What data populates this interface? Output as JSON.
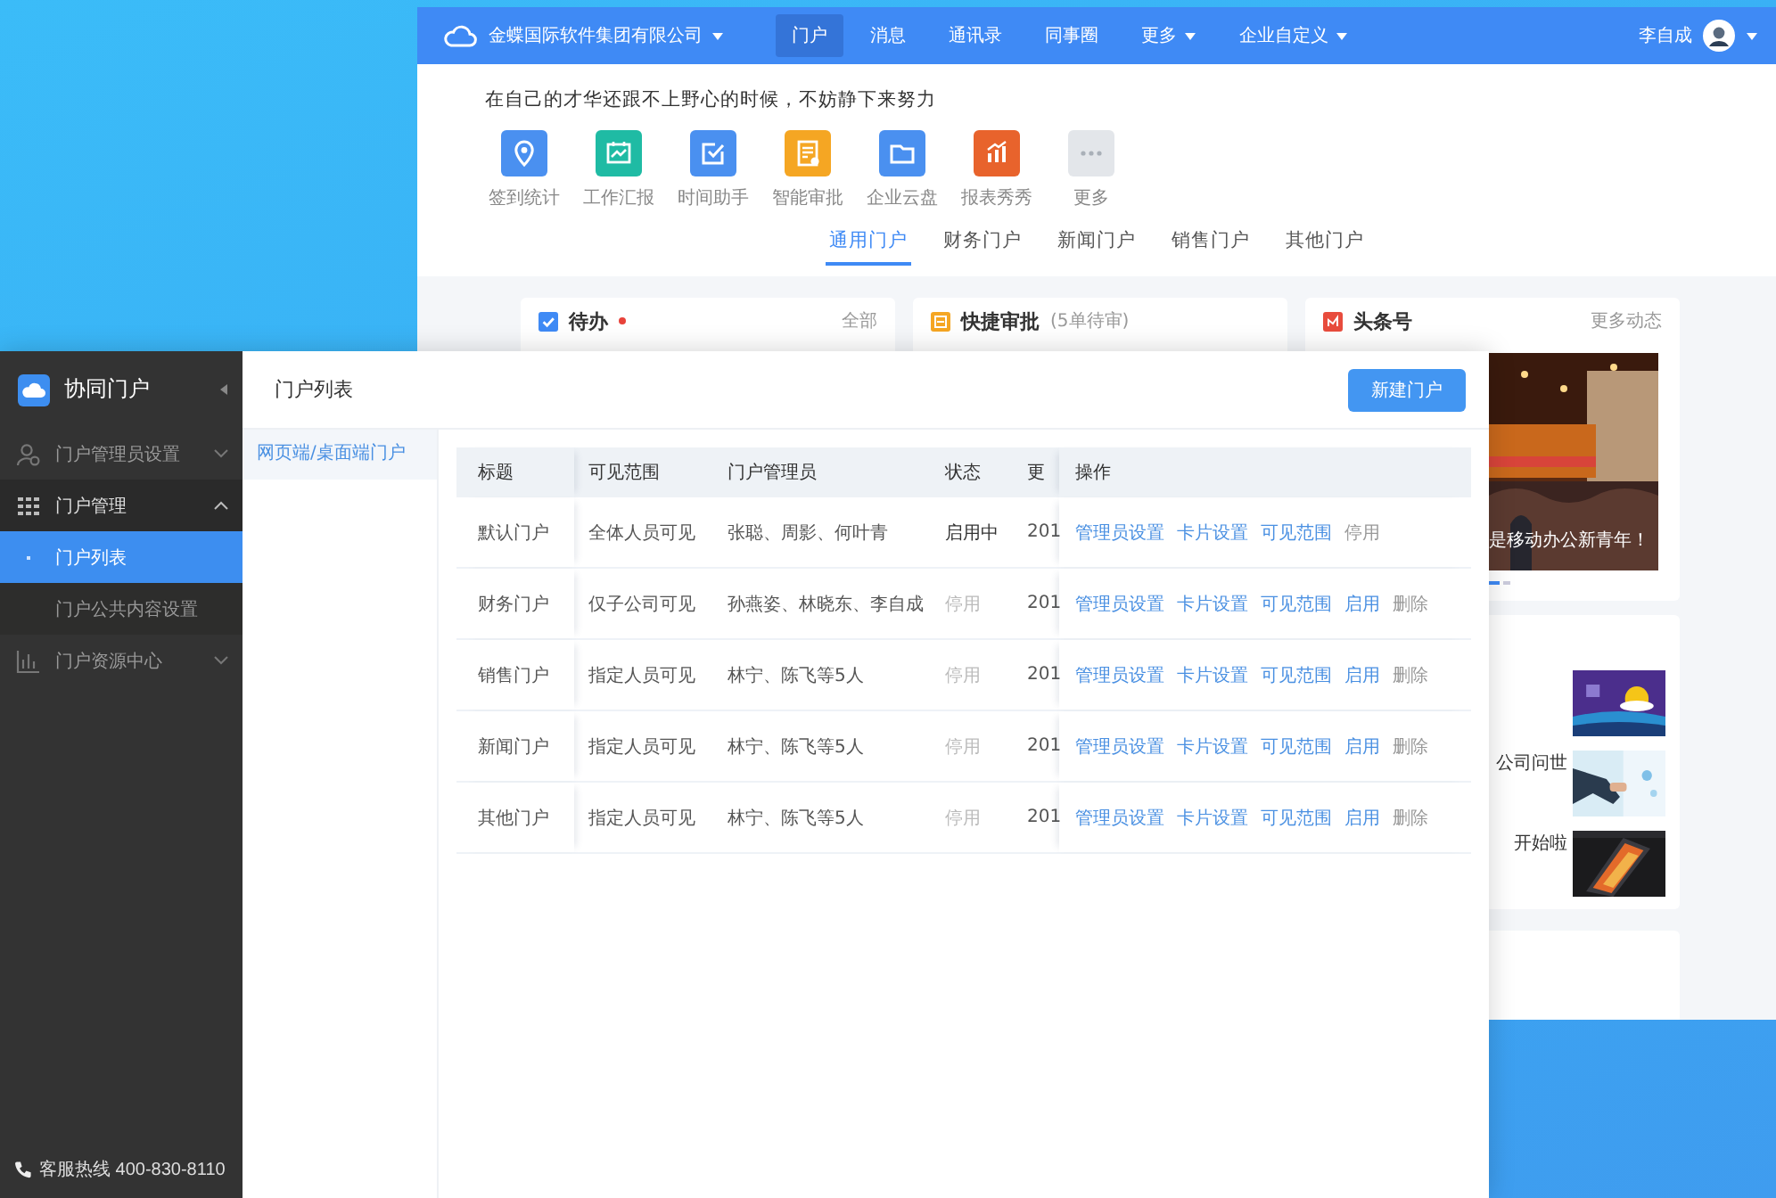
{
  "portal_window": {
    "top_bar": {
      "company": {
        "label": "金蝶国际软件集团有限公司",
        "has_menu": true
      },
      "nav": [
        {
          "label": "门户",
          "selected": true,
          "has_menu": false
        },
        {
          "label": "消息",
          "selected": false,
          "has_menu": false
        },
        {
          "label": "通讯录",
          "selected": false,
          "has_menu": false
        },
        {
          "label": "同事圈",
          "selected": false,
          "has_menu": false
        },
        {
          "label": "更多",
          "selected": false,
          "has_menu": true
        },
        {
          "label": "企业自定义",
          "selected": false,
          "has_menu": true
        }
      ],
      "user_name": "李自成"
    },
    "motto": "在自己的才华还跟不上野心的时候，不妨静下来努力",
    "apps": [
      {
        "label": "签到统计",
        "kind": "pin",
        "color": "#4a90f0"
      },
      {
        "label": "工作汇报",
        "kind": "chart",
        "color": "#1fbba4"
      },
      {
        "label": "时间助手",
        "kind": "check",
        "color": "#4a90f0"
      },
      {
        "label": "智能审批",
        "kind": "doc",
        "color": "#f5a623"
      },
      {
        "label": "企业云盘",
        "kind": "folder",
        "color": "#4a90f0"
      },
      {
        "label": "报表秀秀",
        "kind": "bars",
        "color": "#e8632c"
      },
      {
        "label": "更多",
        "kind": "more",
        "color": "#e3e6ea"
      }
    ],
    "tabs": [
      {
        "label": "通用门户",
        "selected": true
      },
      {
        "label": "财务门户",
        "selected": false
      },
      {
        "label": "新闻门户",
        "selected": false
      },
      {
        "label": "销售门户",
        "selected": false
      },
      {
        "label": "其他门户",
        "selected": false
      }
    ],
    "cards": [
      {
        "kind": "todo",
        "title": "待办",
        "alert": true,
        "link": "全部"
      },
      {
        "kind": "approval",
        "title": "快捷审批",
        "alert": false,
        "note": "(5单待审)"
      },
      {
        "kind": "news",
        "title": "头条号",
        "alert": false,
        "link": "更多动态",
        "caption": "是移动办公新青年！",
        "slides": [
          {
            "selected": true
          },
          {
            "selected": false
          }
        ]
      }
    ],
    "news_list": [
      {
        "kind": "picture"
      },
      {
        "kind": "picture",
        "title": "公司问世"
      },
      {
        "kind": "picture",
        "title": "开始啦"
      }
    ]
  },
  "admin_window": {
    "sidebar": {
      "title": "协同门户",
      "menu": [
        {
          "label": "门户管理员设置",
          "kind": "admin",
          "expanded": false
        },
        {
          "label": "门户管理",
          "kind": "grid",
          "expanded": true,
          "children": [
            {
              "label": "门户列表",
              "selected": true
            },
            {
              "label": "门户公共内容设置",
              "selected": false
            }
          ]
        },
        {
          "label": "门户资源中心",
          "kind": "chart",
          "expanded": false
        }
      ],
      "hotline": "客服热线 400-830-8110"
    },
    "page_title": "门户列表",
    "new_button": "新建门户",
    "sub_nav": [
      {
        "label": "网页端/桌面端门户",
        "selected": true
      }
    ],
    "table": {
      "columns": [
        "标题",
        "可见范围",
        "门户管理员",
        "状态",
        "更",
        "操作"
      ],
      "rows": [
        {
          "title": "默认门户",
          "scope": "全体人员可见",
          "admins": "张聪、周影、何叶青",
          "status": {
            "text": "启用中",
            "active": true
          },
          "updated": "201",
          "actions": [
            {
              "label": "管理员设置",
              "muted": false
            },
            {
              "label": "卡片设置",
              "muted": false
            },
            {
              "label": "可见范围",
              "muted": false
            },
            {
              "label": "停用",
              "muted": true
            }
          ]
        },
        {
          "title": "财务门户",
          "scope": "仅子公司可见",
          "admins": "孙燕姿、林晓东、李自成",
          "status": {
            "text": "停用",
            "active": false
          },
          "updated": "201",
          "actions": [
            {
              "label": "管理员设置",
              "muted": false
            },
            {
              "label": "卡片设置",
              "muted": false
            },
            {
              "label": "可见范围",
              "muted": false
            },
            {
              "label": "启用",
              "muted": false
            },
            {
              "label": "删除",
              "muted": true
            }
          ]
        },
        {
          "title": "销售门户",
          "scope": "指定人员可见",
          "admins": "林宁、陈飞等5人",
          "status": {
            "text": "停用",
            "active": false
          },
          "updated": "201",
          "actions": [
            {
              "label": "管理员设置",
              "muted": false
            },
            {
              "label": "卡片设置",
              "muted": false
            },
            {
              "label": "可见范围",
              "muted": false
            },
            {
              "label": "启用",
              "muted": false
            },
            {
              "label": "删除",
              "muted": true
            }
          ]
        },
        {
          "title": "新闻门户",
          "scope": "指定人员可见",
          "admins": "林宁、陈飞等5人",
          "status": {
            "text": "停用",
            "active": false
          },
          "updated": "201",
          "actions": [
            {
              "label": "管理员设置",
              "muted": false
            },
            {
              "label": "卡片设置",
              "muted": false
            },
            {
              "label": "可见范围",
              "muted": false
            },
            {
              "label": "启用",
              "muted": false
            },
            {
              "label": "删除",
              "muted": true
            }
          ]
        },
        {
          "title": "其他门户",
          "scope": "指定人员可见",
          "admins": "林宁、陈飞等5人",
          "status": {
            "text": "停用",
            "active": false
          },
          "updated": "201",
          "actions": [
            {
              "label": "管理员设置",
              "muted": false
            },
            {
              "label": "卡片设置",
              "muted": false
            },
            {
              "label": "可见范围",
              "muted": false
            },
            {
              "label": "启用",
              "muted": false
            },
            {
              "label": "删除",
              "muted": true
            }
          ]
        }
      ]
    }
  }
}
